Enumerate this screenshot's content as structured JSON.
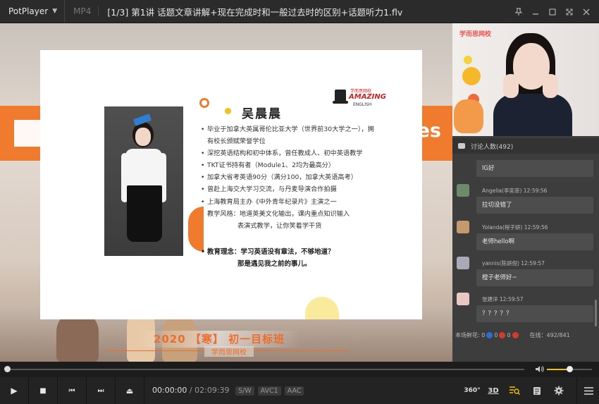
{
  "titlebar": {
    "app_name": "PotPlayer",
    "format": "MP4",
    "title": "[1/3] 第1讲 话题文章讲解+现在完成时和一般过去时的区别+话题听力1.flv"
  },
  "video": {
    "banner_text": "es",
    "bottom_title": "2020 【寒】 初一目标班",
    "bottom_sub": "学而思网校"
  },
  "slide": {
    "name": "吴晨晨",
    "logo_top": "学而思网校",
    "logo_main": "AMAZING",
    "logo_sub": "ENGLISH",
    "bullets": [
      {
        "text": "毕业于加拿大英属哥伦比亚大学（世界前30大学之一），拥",
        "type": "bullet"
      },
      {
        "text": "有校长颁赋荣誉学位",
        "type": "cont"
      },
      {
        "text": "深挖英语结构和初中体系，曾任教成人、初中英语教学",
        "type": "bullet"
      },
      {
        "text": "TKT证书持有者（Module1、2均为最高分）",
        "type": "bullet"
      },
      {
        "text": "加拿大省考英语90分（满分100，加拿大英语高考）",
        "type": "bullet"
      },
      {
        "text": "曾赴上海交大学习交流，与丹麦导演合作拍摄",
        "type": "bullet"
      },
      {
        "text": "上海教育局主办《中外青年纪录片》主演之一",
        "type": "bullet"
      },
      {
        "text": "教学风格：地道英美文化输出，课内重点知识输入",
        "type": "bullet"
      },
      {
        "text": "表演式教学，让你笑着学干货",
        "type": "indent"
      }
    ],
    "philosophy_1": "教育理念：学习英语没有章法，不够地道？",
    "philosophy_2": "那是遇见我之前的事儿。"
  },
  "camera": {
    "logo": "学而思网校"
  },
  "chat": {
    "header": "讨论人数(492)",
    "messages": [
      {
        "meta": "",
        "text": "lG好"
      },
      {
        "meta": "Angelia(李奕菲)  12:59:56",
        "text": "拉切没错了"
      },
      {
        "meta": "Yolanda(程子妍)  12:59:56",
        "text": "老师hello啊"
      },
      {
        "meta": "yannis(陈妍倪)  12:59:57",
        "text": "橙子老师好~"
      },
      {
        "meta": "张建洋  12:59:57",
        "text": "？？？？？"
      }
    ],
    "footer_label": "本场鲜花:",
    "footer_counts": [
      "0",
      "0",
      "0"
    ],
    "online": "在线：492/841"
  },
  "controls": {
    "play_icon": "▶",
    "stop_icon": "■",
    "prev_icon": "⏮",
    "next_icon": "⏭",
    "eject_icon": "⏏",
    "current_time": "00:00:00",
    "separator": "/",
    "total_time": "02:09:39",
    "tags": [
      "S/W",
      "AVC1",
      "AAC"
    ],
    "label_360": "360°",
    "label_3d": "3D",
    "seek_position": 0,
    "volume": 0.5
  },
  "colors": {
    "accent_orange": "#f07a2e",
    "volume_yellow": "#f2c200"
  }
}
